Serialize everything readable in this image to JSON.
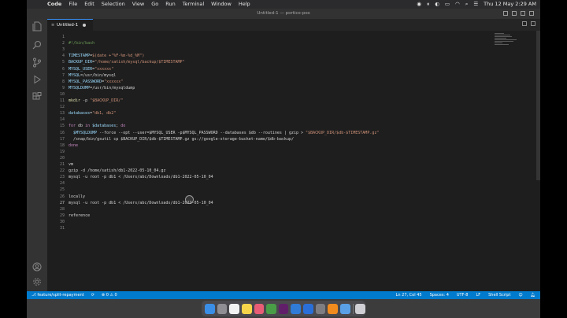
{
  "menubar": {
    "app_name": "Code",
    "menus": [
      "File",
      "Edit",
      "Selection",
      "View",
      "Go",
      "Run",
      "Terminal",
      "Window",
      "Help"
    ],
    "clock": "Thu 12 May  2:29 AM"
  },
  "window": {
    "title": "Untitled-1 — portico-pos"
  },
  "tab": {
    "label": "Untitled-1"
  },
  "editor": {
    "active_line": 27,
    "lines": [
      {
        "n": "1",
        "segs": []
      },
      {
        "n": "2",
        "segs": [
          {
            "c": "cm",
            "t": "#!/bin/bash"
          }
        ]
      },
      {
        "n": "3",
        "segs": []
      },
      {
        "n": "4",
        "segs": [
          {
            "c": "var",
            "t": "TIMESTAMP"
          },
          {
            "c": "def",
            "t": "="
          },
          {
            "c": "str",
            "t": "$(date +\"%F-%m-%d_%M\")"
          }
        ]
      },
      {
        "n": "5",
        "segs": [
          {
            "c": "var",
            "t": "BACKUP_DIR"
          },
          {
            "c": "def",
            "t": "="
          },
          {
            "c": "str",
            "t": "\"/home/satish/mysql/backup/$TIMESTAMP\""
          }
        ]
      },
      {
        "n": "6",
        "segs": [
          {
            "c": "var",
            "t": "MYSQL_USER"
          },
          {
            "c": "def",
            "t": "="
          },
          {
            "c": "str",
            "t": "\"xxxxxx\""
          }
        ]
      },
      {
        "n": "7",
        "segs": [
          {
            "c": "var",
            "t": "MYSQL"
          },
          {
            "c": "def",
            "t": "=/usr/bin/mysql"
          }
        ]
      },
      {
        "n": "8",
        "segs": [
          {
            "c": "var",
            "t": "MYSQL_PASSWORD"
          },
          {
            "c": "def",
            "t": "="
          },
          {
            "c": "str",
            "t": "\"xxxxxx\""
          }
        ]
      },
      {
        "n": "9",
        "segs": [
          {
            "c": "var",
            "t": "MYSQLDUMP"
          },
          {
            "c": "def",
            "t": "=/usr/bin/mysqldump"
          }
        ]
      },
      {
        "n": "10",
        "segs": []
      },
      {
        "n": "11",
        "segs": [
          {
            "c": "fn",
            "t": "mkdir"
          },
          {
            "c": "def",
            "t": " -p "
          },
          {
            "c": "str",
            "t": "\"$BACKUP_DIR/\""
          }
        ]
      },
      {
        "n": "12",
        "segs": []
      },
      {
        "n": "13",
        "segs": [
          {
            "c": "var",
            "t": "databases"
          },
          {
            "c": "def",
            "t": "="
          },
          {
            "c": "str",
            "t": "\"db1, db2\""
          }
        ]
      },
      {
        "n": "14",
        "segs": []
      },
      {
        "n": "15",
        "segs": [
          {
            "c": "kw",
            "t": "for"
          },
          {
            "c": "def",
            "t": " db "
          },
          {
            "c": "kw",
            "t": "in"
          },
          {
            "c": "def",
            "t": " "
          },
          {
            "c": "var",
            "t": "$databases"
          },
          {
            "c": "def",
            "t": "; "
          },
          {
            "c": "kw",
            "t": "do"
          }
        ]
      },
      {
        "n": "16",
        "segs": [
          {
            "c": "def",
            "t": "  "
          },
          {
            "c": "var",
            "t": "$MYSQLDUMP"
          },
          {
            "c": "def",
            "t": " --force --opt --user=$MYSQL_USER -p$MYSQL_PASSWORD --databases $db --routines | gzip > "
          },
          {
            "c": "str",
            "t": "\"$BACKUP_DIR/$db-$TIMESTAMP.gz\""
          }
        ]
      },
      {
        "n": "17",
        "segs": [
          {
            "c": "def",
            "t": "  /snap/bin/gsutil cp $BACKUP_DIR/$db-$TIMESTAMP.gz gs://google-storage-bucket-name/$db-backup/"
          }
        ]
      },
      {
        "n": "18",
        "segs": [
          {
            "c": "kw",
            "t": "done"
          }
        ]
      },
      {
        "n": "19",
        "segs": []
      },
      {
        "n": "20",
        "segs": []
      },
      {
        "n": "21",
        "segs": [
          {
            "c": "def",
            "t": "vm"
          }
        ]
      },
      {
        "n": "22",
        "segs": [
          {
            "c": "def",
            "t": "gzip -d /home/satish/db1-2022-05-10_04.gz"
          }
        ]
      },
      {
        "n": "23",
        "segs": [
          {
            "c": "def",
            "t": "mysql -u root -p db1 < /Users/abc/Downloads/db1-2022-05-10_04"
          }
        ]
      },
      {
        "n": "24",
        "segs": []
      },
      {
        "n": "25",
        "segs": []
      },
      {
        "n": "26",
        "segs": [
          {
            "c": "def",
            "t": "locally"
          }
        ]
      },
      {
        "n": "27",
        "segs": [
          {
            "c": "def",
            "t": "mysql -u root -p db1 < /Users/abc/Downloads/db1-2022-05-10_04"
          }
        ]
      },
      {
        "n": "28",
        "segs": []
      },
      {
        "n": "29",
        "segs": [
          {
            "c": "def",
            "t": "reference"
          }
        ]
      },
      {
        "n": "30",
        "segs": []
      },
      {
        "n": "31",
        "segs": []
      }
    ]
  },
  "statusbar": {
    "branch": "feature/split-repayment",
    "problems": "⊗ 0 ⚠ 0",
    "position": "Ln 27, Col 45",
    "spaces": "Spaces: 4",
    "encoding": "UTF-8",
    "eol": "LF",
    "language": "Shell Script"
  },
  "colors": {
    "status_bar": "#007acc",
    "editor_bg": "#1e1e1e",
    "activity_bar": "#333333"
  },
  "dock_icons": [
    "finder-icon",
    "launchpad-icon",
    "calendar-icon",
    "notes-icon",
    "photos-icon",
    "chrome-icon",
    "slack-icon",
    "vscode-icon",
    "xcode-icon",
    "settings-icon",
    "sublime-icon",
    "preview-icon",
    "trash-icon"
  ]
}
